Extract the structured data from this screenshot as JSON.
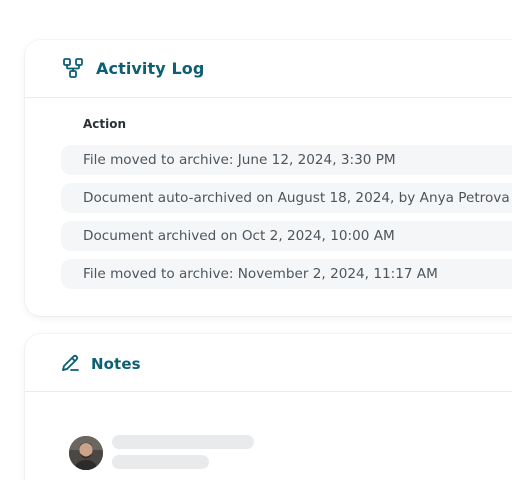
{
  "activity": {
    "title": "Activity Log",
    "icon": "workflow-icon",
    "column_header": "Action",
    "rows": [
      "File moved to archive: June 12, 2024, 3:30 PM",
      "Document auto-archived on August 18, 2024, by Anya Petrova",
      "Document archived on Oct 2, 2024, 10:00 AM",
      "File moved to archive: November 2, 2024, 11:17 AM"
    ]
  },
  "notes": {
    "title": "Notes",
    "icon": "pencil-icon"
  },
  "colors": {
    "accent": "#0d5f73",
    "row_background": "#f5f6f7",
    "skeleton": "#e8eaec"
  }
}
